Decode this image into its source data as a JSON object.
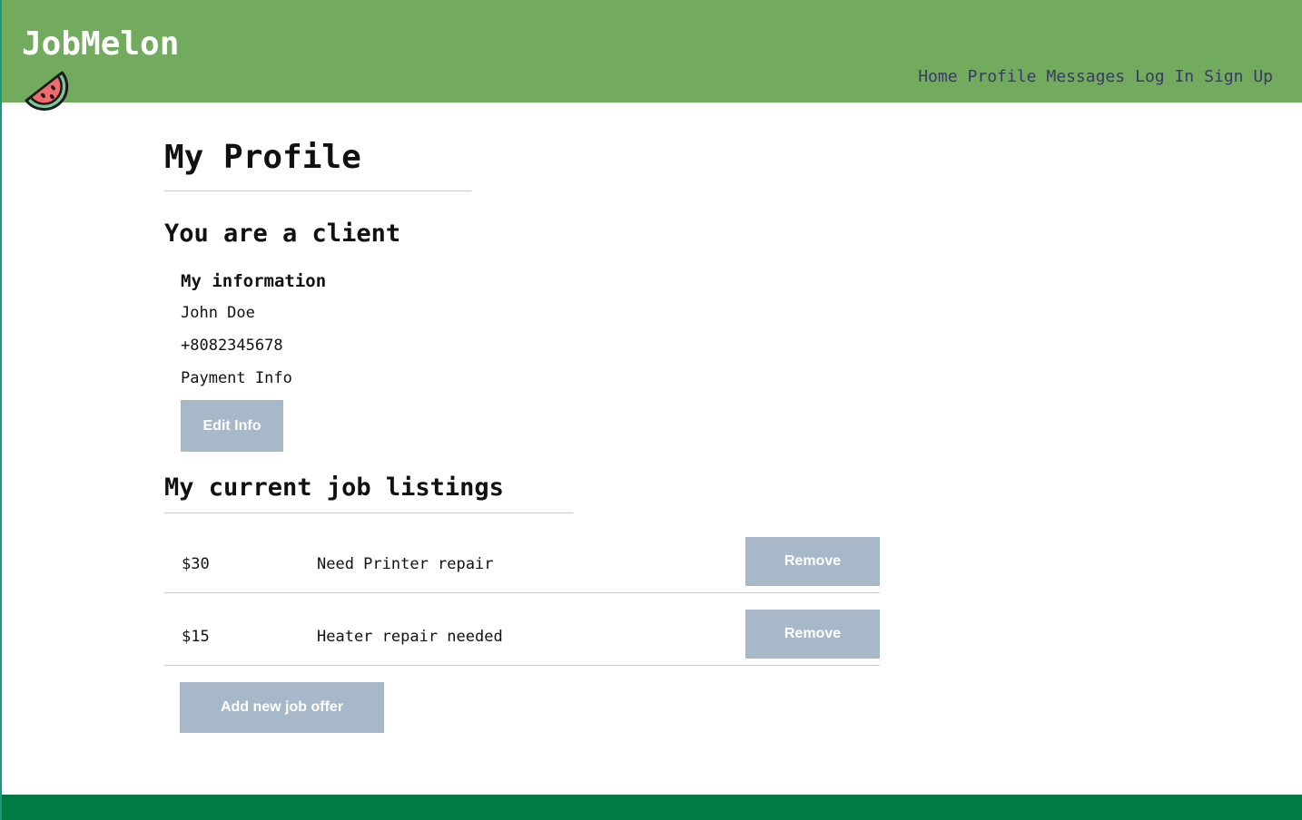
{
  "brand": {
    "name": "JobMelon",
    "logo_icon": "watermelon-slice-icon"
  },
  "nav": {
    "items": [
      {
        "label": "Home"
      },
      {
        "label": "Profile"
      },
      {
        "label": "Messages"
      },
      {
        "label": "Log In"
      },
      {
        "label": "Sign Up"
      }
    ]
  },
  "profile": {
    "title": "My Profile",
    "role": "You are a client",
    "info_heading": "My information",
    "name": "John Doe",
    "phone": "+8082345678",
    "payment": "Payment Info",
    "edit_label": "Edit Info"
  },
  "listings": {
    "title": "My current job listings",
    "items": [
      {
        "price": "$30",
        "title": "Need Printer repair",
        "remove_label": "Remove"
      },
      {
        "price": "$15",
        "title": "Heater repair needed",
        "remove_label": "Remove"
      }
    ],
    "add_label": "Add new job offer"
  },
  "colors": {
    "header": "#72aa5e",
    "footer": "#017a43",
    "button": "#a7b8c9",
    "nav_text": "#3a3a66"
  }
}
